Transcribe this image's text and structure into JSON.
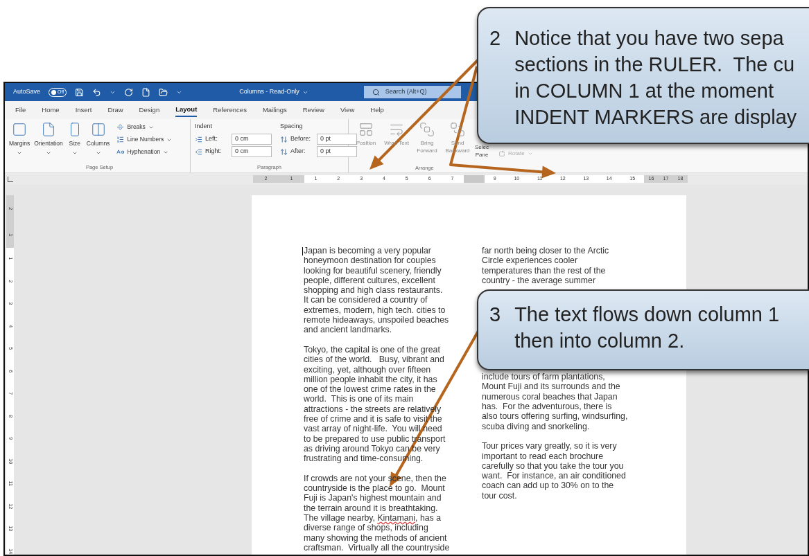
{
  "title_bar": {
    "autosave_label": "AutoSave",
    "autosave_state": "Off",
    "autosave_on": false,
    "document_title": "Columns - Read-Only",
    "search_placeholder": "Search (Alt+Q)"
  },
  "ribbon_tabs": [
    {
      "label": "File",
      "selected": false
    },
    {
      "label": "Home",
      "selected": false
    },
    {
      "label": "Insert",
      "selected": false
    },
    {
      "label": "Draw",
      "selected": false
    },
    {
      "label": "Design",
      "selected": false
    },
    {
      "label": "Layout",
      "selected": true
    },
    {
      "label": "References",
      "selected": false
    },
    {
      "label": "Mailings",
      "selected": false
    },
    {
      "label": "Review",
      "selected": false
    },
    {
      "label": "View",
      "selected": false
    },
    {
      "label": "Help",
      "selected": false
    }
  ],
  "ribbon": {
    "page_setup": {
      "label": "Page Setup",
      "buttons": [
        "Margins",
        "Orientation",
        "Size",
        "Columns"
      ],
      "small_buttons": [
        "Breaks",
        "Line Numbers",
        "Hyphenation"
      ]
    },
    "paragraph": {
      "label": "Paragraph",
      "indent_label": "Indent",
      "spacing_label": "Spacing",
      "indent_fields": [
        {
          "label": "Left:",
          "value": "0 cm"
        },
        {
          "label": "Right:",
          "value": "0 cm"
        }
      ],
      "spacing_fields": [
        {
          "label": "Before:",
          "value": "0 pt"
        },
        {
          "label": "After:",
          "value": "0 pt"
        }
      ]
    },
    "arrange": {
      "label": "Arrange",
      "buttons": [
        {
          "label": "Position",
          "disabled": true
        },
        {
          "label": "Wrap Text",
          "disabled": true
        },
        {
          "label": "Bring Forward",
          "disabled": true
        },
        {
          "label": "Send Backward",
          "disabled": true
        }
      ],
      "selection_pane": {
        "label_lines": [
          "Selec",
          "Pane"
        ]
      },
      "rotate": {
        "label": "Rotate",
        "disabled": true
      }
    }
  },
  "ruler": {
    "sections": [
      {
        "kind": "margin",
        "labels": [
          "2",
          "1"
        ]
      },
      {
        "kind": "column",
        "labels": [
          "1",
          "2",
          "3",
          "4",
          "5",
          "6",
          "7"
        ]
      },
      {
        "kind": "gap"
      },
      {
        "kind": "column",
        "labels": [
          "9",
          "10",
          "11",
          "12",
          "13",
          "14",
          "15"
        ]
      },
      {
        "kind": "margin",
        "labels": [
          "16",
          "17",
          "18"
        ]
      }
    ]
  },
  "vertical_ruler": {
    "sections": [
      {
        "kind": "margin",
        "labels": [
          "2",
          "1"
        ]
      },
      {
        "kind": "column",
        "labels": [
          "1",
          "2",
          "3",
          "4",
          "5",
          "6",
          "7",
          "8",
          "9",
          "10",
          "11",
          "12",
          "13",
          "14"
        ]
      }
    ]
  },
  "document": {
    "columns": [
      {
        "paragraphs": [
          {
            "text": "Japan is becoming a very popular\nhoneymoon destination for couples\nlooking for beautiful scenery, friendly\npeople, different cultures, excellent\nshopping and high class restaurants.\nIt can be considered a country of\nextremes, modern, high tech. cities to\nremote hideaways, unspoiled beaches\nand ancient landmarks."
          },
          {
            "text": "Tokyo, the capital is one of the great\ncities of the world.   Busy, vibrant and\nexciting, yet, although over fifteen\nmillion people inhabit the city, it has\none of the lowest crime rates in the\nworld.  This is one of its main\nattractions - the streets are relatively\nfree of crime and it is safe to visit the\nvast array of night-life.  You will need\nto be prepared to use public transport\nas driving around Tokyo can be very\nfrustrating and time-consuming."
          },
          {
            "parts": [
              {
                "text": "If crowds are not your scene, then the\ncountryside is the place to go.  Mount\nFuji is Japan's highest mountain and\nthe terrain around it is breathtaking.\nThe village nearby, ",
                "spelling_error": false
              },
              {
                "text": "Kintamani",
                "spelling_error": true
              },
              {
                "text": ", has a\ndiverse range of shops, including\nmany showing the methods of ancient\ncraftsman.  Virtually all the countryside",
                "spelling_error": false
              }
            ]
          }
        ]
      },
      {
        "paragraphs": [
          {
            "text": "far north being closer to the Arctic\nCircle experiences cooler\ntemperatures than the rest of the\ncountry - the average summer"
          },
          {
            "text": "include tours of farm plantations,\nMount Fuji and its surrounds and the\nnumerous coral beaches that Japan\nhas.  For the adventurous, there is\nalso tours offering surfing, windsurfing,\nscuba diving and snorkeling."
          },
          {
            "text": "Tour prices vary greatly, so it is very\nimportant to read each brochure\ncarefully so that you take the tour you\nwant.  For instance, an air conditioned\ncoach can add up to 30% on to the\ntour cost."
          }
        ]
      }
    ]
  },
  "callouts": [
    {
      "number": "2",
      "lines": [
        "Notice that you have two sepa",
        "sections in the RULER.  The cu",
        "in COLUMN 1 at the moment",
        "INDENT MARKERS are display"
      ]
    },
    {
      "number": "3",
      "lines": [
        "The text flows down column 1",
        "then into column 2."
      ]
    }
  ]
}
